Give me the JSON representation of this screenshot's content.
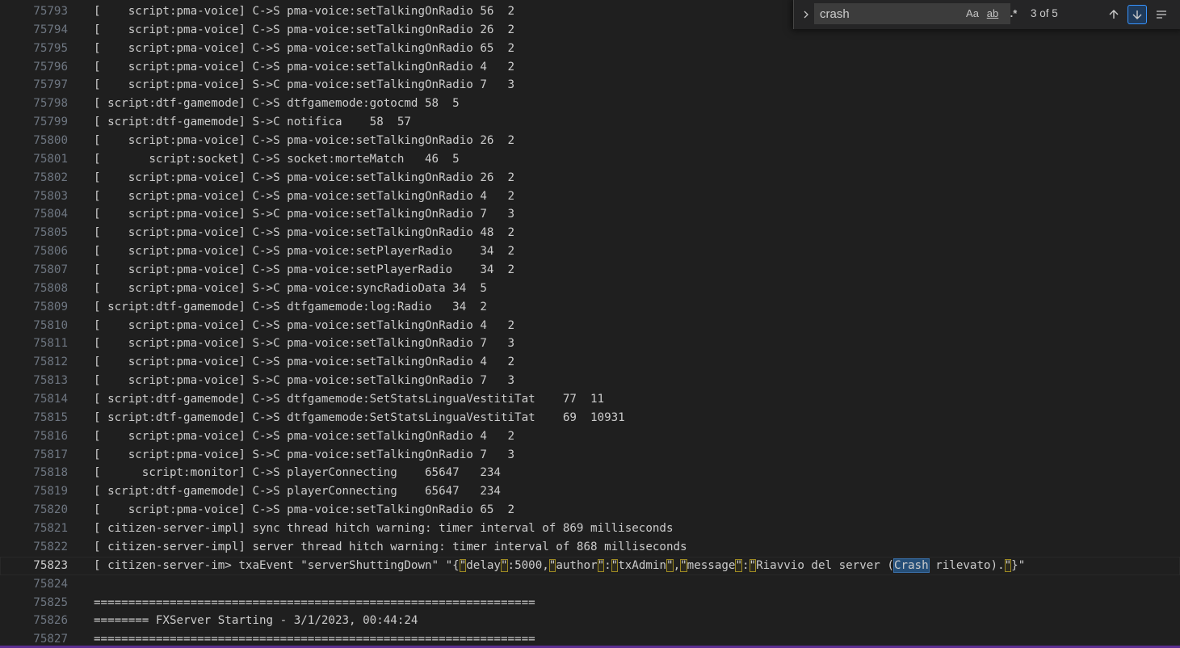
{
  "editor": {
    "lines": [
      {
        "n": "75793",
        "t": "[    script:pma-voice] C->S pma-voice:setTalkingOnRadio 56  2"
      },
      {
        "n": "75794",
        "t": "[    script:pma-voice] C->S pma-voice:setTalkingOnRadio 26  2"
      },
      {
        "n": "75795",
        "t": "[    script:pma-voice] C->S pma-voice:setTalkingOnRadio 65  2"
      },
      {
        "n": "75796",
        "t": "[    script:pma-voice] C->S pma-voice:setTalkingOnRadio 4   2"
      },
      {
        "n": "75797",
        "t": "[    script:pma-voice] S->C pma-voice:setTalkingOnRadio 7   3"
      },
      {
        "n": "75798",
        "t": "[ script:dtf-gamemode] C->S dtfgamemode:gotocmd 58  5"
      },
      {
        "n": "75799",
        "t": "[ script:dtf-gamemode] S->C notifica    58  57"
      },
      {
        "n": "75800",
        "t": "[    script:pma-voice] C->S pma-voice:setTalkingOnRadio 26  2"
      },
      {
        "n": "75801",
        "t": "[       script:socket] C->S socket:morteMatch   46  5"
      },
      {
        "n": "75802",
        "t": "[    script:pma-voice] C->S pma-voice:setTalkingOnRadio 26  2"
      },
      {
        "n": "75803",
        "t": "[    script:pma-voice] C->S pma-voice:setTalkingOnRadio 4   2"
      },
      {
        "n": "75804",
        "t": "[    script:pma-voice] S->C pma-voice:setTalkingOnRadio 7   3"
      },
      {
        "n": "75805",
        "t": "[    script:pma-voice] C->S pma-voice:setTalkingOnRadio 48  2"
      },
      {
        "n": "75806",
        "t": "[    script:pma-voice] C->S pma-voice:setPlayerRadio    34  2"
      },
      {
        "n": "75807",
        "t": "[    script:pma-voice] C->S pma-voice:setPlayerRadio    34  2"
      },
      {
        "n": "75808",
        "t": "[    script:pma-voice] S->C pma-voice:syncRadioData 34  5"
      },
      {
        "n": "75809",
        "t": "[ script:dtf-gamemode] C->S dtfgamemode:log:Radio   34  2"
      },
      {
        "n": "75810",
        "t": "[    script:pma-voice] C->S pma-voice:setTalkingOnRadio 4   2"
      },
      {
        "n": "75811",
        "t": "[    script:pma-voice] S->C pma-voice:setTalkingOnRadio 7   3"
      },
      {
        "n": "75812",
        "t": "[    script:pma-voice] C->S pma-voice:setTalkingOnRadio 4   2"
      },
      {
        "n": "75813",
        "t": "[    script:pma-voice] S->C pma-voice:setTalkingOnRadio 7   3"
      },
      {
        "n": "75814",
        "t": "[ script:dtf-gamemode] C->S dtfgamemode:SetStatsLinguaVestitiTat    77  11"
      },
      {
        "n": "75815",
        "t": "[ script:dtf-gamemode] C->S dtfgamemode:SetStatsLinguaVestitiTat    69  10931"
      },
      {
        "n": "75816",
        "t": "[    script:pma-voice] C->S pma-voice:setTalkingOnRadio 4   2"
      },
      {
        "n": "75817",
        "t": "[    script:pma-voice] S->C pma-voice:setTalkingOnRadio 7   3"
      },
      {
        "n": "75818",
        "t": "[      script:monitor] C->S playerConnecting    65647   234"
      },
      {
        "n": "75819",
        "t": "[ script:dtf-gamemode] C->S playerConnecting    65647   234"
      },
      {
        "n": "75820",
        "t": "[    script:pma-voice] C->S pma-voice:setTalkingOnRadio 65  2"
      },
      {
        "n": "75821",
        "t": "[ citizen-server-impl] sync thread hitch warning: timer interval of 869 milliseconds"
      },
      {
        "n": "75822",
        "t": "[ citizen-server-impl] server thread hitch warning: timer interval of 868 milliseconds"
      },
      {
        "n": "75823",
        "current": true,
        "segments": [
          {
            "t": "[ citizen-server-im> txaEvent \"serverShuttingDown\" \"{"
          },
          {
            "t": "\"",
            "mark": "match"
          },
          {
            "t": "delay"
          },
          {
            "t": "\"",
            "mark": "match"
          },
          {
            "t": ":5000,"
          },
          {
            "t": "\"",
            "mark": "match"
          },
          {
            "t": "author"
          },
          {
            "t": "\"",
            "mark": "match"
          },
          {
            "t": ":"
          },
          {
            "t": "\"",
            "mark": "match"
          },
          {
            "t": "txAdmin"
          },
          {
            "t": "\"",
            "mark": "match"
          },
          {
            "t": ","
          },
          {
            "t": "\"",
            "mark": "match"
          },
          {
            "t": "message"
          },
          {
            "t": "\"",
            "mark": "match"
          },
          {
            "t": ":"
          },
          {
            "t": "\"",
            "mark": "match"
          },
          {
            "t": "Riavvio del server ("
          },
          {
            "t": "Crash",
            "mark": "current"
          },
          {
            "t": " rilevato)."
          },
          {
            "t": "\"",
            "mark": "match"
          },
          {
            "t": "}\""
          }
        ]
      },
      {
        "n": "75824",
        "t": ""
      },
      {
        "n": "75825",
        "t": "================================================================"
      },
      {
        "n": "75826",
        "t": "======== FXServer Starting - 3/1/2023, 00:44:24"
      },
      {
        "n": "75827",
        "t": "================================================================"
      }
    ]
  },
  "find": {
    "toggle_icon": "chevron-right-icon",
    "query": "crash",
    "options": {
      "match_case": "Aa",
      "whole_word": "ab",
      "regex": ".*"
    },
    "count": "3 of 5",
    "prev_icon": "arrow-up-icon",
    "next_icon": "arrow-down-icon",
    "selection_icon": "find-in-selection-icon"
  },
  "colors": {
    "background": "#1f1f1f",
    "text": "#cccccc",
    "line_number": "#6e7681",
    "match_border": "#9e8a22",
    "current_match": "#264f78",
    "find_widget_bg": "#252526",
    "accent_bar": "#5c2d91"
  }
}
